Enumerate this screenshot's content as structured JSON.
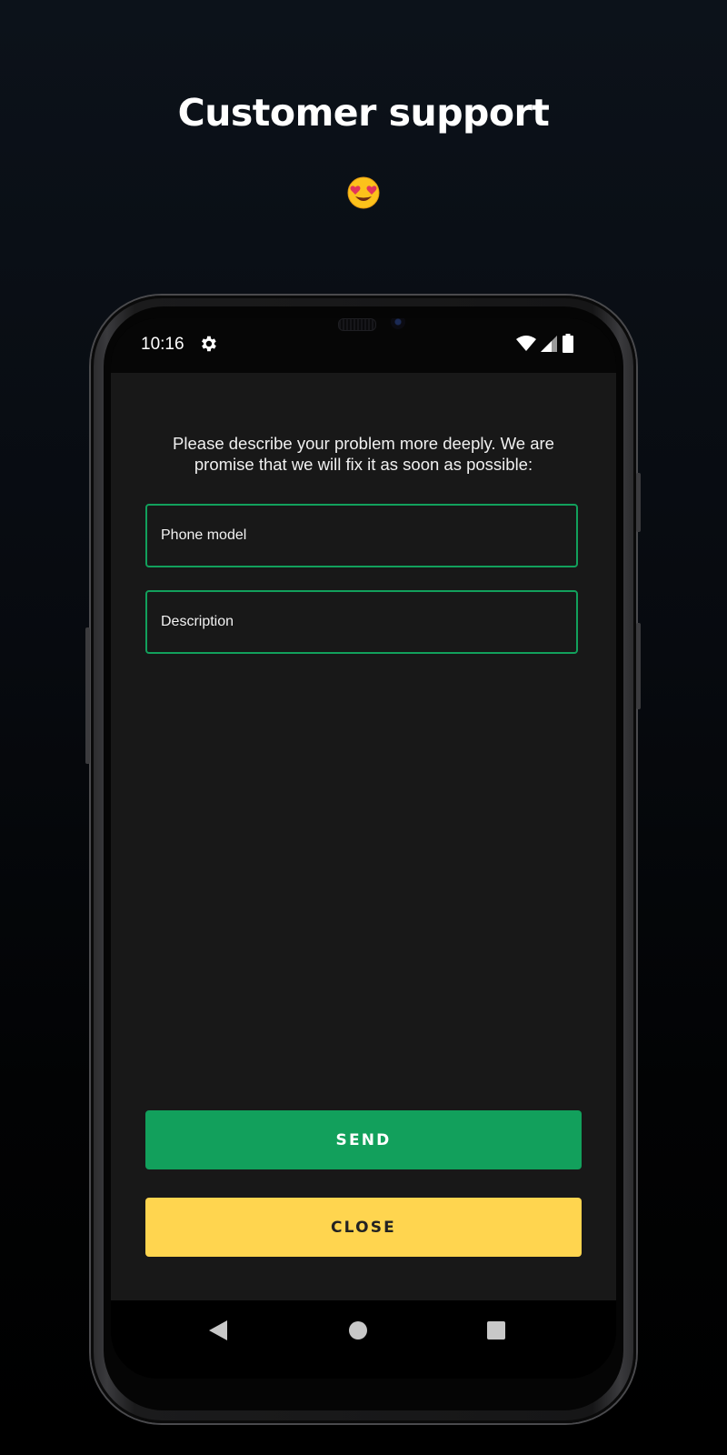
{
  "promo": {
    "title": "Customer support",
    "emoji_icon": "heart-eyes-emoji-icon"
  },
  "status_bar": {
    "time": "10:16",
    "icons": [
      "gear-icon",
      "wifi-icon",
      "signal-icon",
      "battery-icon"
    ]
  },
  "form": {
    "instruction": "Please describe your problem more deeply. We are promise that we will fix it as soon as possible:",
    "phone_model_placeholder": "Phone model",
    "description_placeholder": "Description",
    "send_label": "SEND",
    "close_label": "CLOSE"
  },
  "nav_bar": {
    "icons": [
      "back-icon",
      "home-icon",
      "recents-icon"
    ]
  },
  "colors": {
    "accent_green": "#12a05c",
    "close_yellow": "#ffd54f",
    "screen_bg": "#181818"
  }
}
